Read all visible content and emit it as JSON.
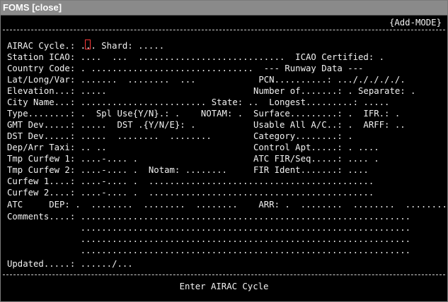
{
  "window": {
    "title": "FOMS",
    "close_label": "[close]"
  },
  "screen": {
    "mode": "{Add-MODE}",
    "lines": [
      "AIRAC Cycle.: ... Shard: .....",
      "Station ICAO: ....  ...  ............................  ICAO Certified: .",
      "Country Code: . ...............................  --- Runway Data ---",
      "Lat/Long/Var: .......  ........  ...            PCN..........: .../././././.",
      "Elevation...: .....                            Number of.......: . Separate: .",
      "City Name...: ........................ State: ..  Longest.........: .....",
      "Type........: .  Spl Use{Y/N}.: .    NOTAM: .  Surface.........: .  IFR.: .",
      "GMT Dev.....: .....  DST .{Y/N/E}: .           Usable All A/C..: .  ARFF: ..",
      "DST Dev.....: .....  ........  ........        Category........: .",
      "Dep/Arr Taxi: .. ..                            Control Apt.....: . ....",
      "Tmp Curfew 1: ....-.... .                      ATC FIR/Seq.....: .... .",
      "Tmp Curfew 2: ....-.... .  Notam: ........     FIR Ident.......: ....",
      "Curfew 1....: ....-.... .  ...........................................",
      "Curfew 2....: ....-.... .  ...........................................",
      "ATC     DEP: .  ........  ........  ........    ARR: .  ........  ........  ........",
      "Comments....: ...............................................................",
      "              ...............................................................",
      "              ...............................................................",
      "              ...............................................................",
      "Updated.....: ....../..."
    ],
    "prompt": "Enter AIRAC Cycle"
  }
}
